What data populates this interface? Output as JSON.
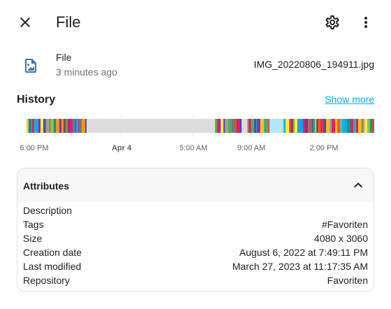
{
  "header": {
    "title": "File",
    "close_icon": "close-icon",
    "settings_icon": "gear-icon",
    "more_icon": "dots-vertical-icon"
  },
  "entity": {
    "icon": "file-image-icon",
    "name": "File",
    "last_changed": "3 minutes ago",
    "state": "IMG_20220806_194911.jpg"
  },
  "history": {
    "title": "History",
    "show_more_label": "Show more",
    "ticks": [
      {
        "label": "6:00 PM",
        "major": false
      },
      {
        "label": "Apr 4",
        "major": true
      },
      {
        "label": "5:00 AM",
        "major": false
      },
      {
        "label": "9:00 AM",
        "major": false
      },
      {
        "label": "2:00 PM",
        "major": false
      }
    ]
  },
  "attributes": {
    "header_label": "Attributes",
    "rows": [
      {
        "name": "Description",
        "value": ""
      },
      {
        "name": "Tags",
        "value": "#Favoriten"
      },
      {
        "name": "Size",
        "value": "4080 x 3060"
      },
      {
        "name": "Creation date",
        "value": "August 6, 2022 at 7:49:11 PM"
      },
      {
        "name": "Last modified",
        "value": "March 27, 2023 at 11:17:35 AM"
      },
      {
        "name": "Repository",
        "value": "Favoriten"
      }
    ]
  },
  "colors": {
    "accent_link": "#03a9f4",
    "entity_icon": "#44739e",
    "timeline_idle": "#dcdcdc"
  }
}
